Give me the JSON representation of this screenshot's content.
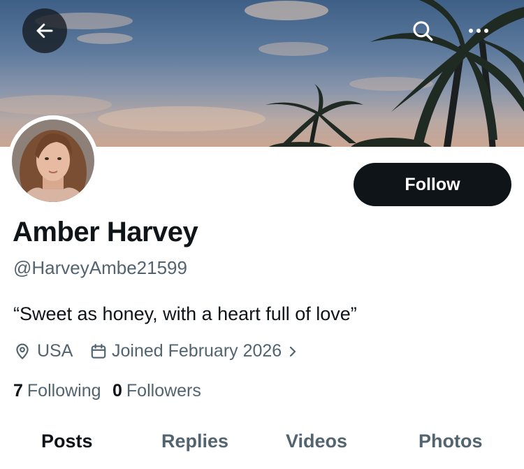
{
  "header": {
    "back_icon": "arrow-left-icon",
    "search_icon": "search-icon",
    "more_icon": "more-horizontal-icon"
  },
  "profile": {
    "name": "Amber Harvey",
    "handle": "@HarveyAmbe21599",
    "bio": "“Sweet as honey, with a heart full of love”",
    "location": "USA",
    "joined": "Joined February 2026",
    "following_count": "7",
    "following_label": "Following",
    "followers_count": "0",
    "followers_label": "Followers"
  },
  "actions": {
    "follow_label": "Follow"
  },
  "tabs": [
    {
      "label": "Posts",
      "active": true
    },
    {
      "label": "Replies",
      "active": false
    },
    {
      "label": "Videos",
      "active": false
    },
    {
      "label": "Photos",
      "active": false
    }
  ],
  "colors": {
    "primary_text": "#0f1419",
    "secondary_text": "#536471",
    "follow_button_bg": "#0f1419"
  }
}
